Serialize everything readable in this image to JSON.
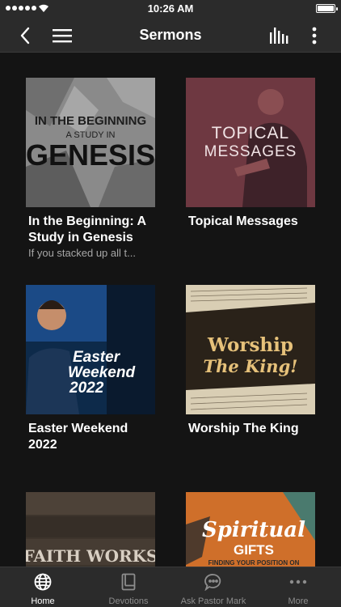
{
  "status_bar": {
    "time": "10:26 AM",
    "battery_level": 1.0
  },
  "nav": {
    "title": "Sermons"
  },
  "cards": [
    {
      "title": "In the Beginning: A Study in Genesis",
      "subtitle": "If you stacked up all t...",
      "art": {
        "line1": "IN THE BEGINNING",
        "line2": "A STUDY IN",
        "line3": "GENESIS"
      }
    },
    {
      "title": "Topical Messages",
      "subtitle": "",
      "art": {
        "line1": "TOPICAL",
        "line2": "MESSAGES"
      }
    },
    {
      "title": "Easter Weekend 2022",
      "subtitle": "",
      "art": {
        "line1": "Easter",
        "line2": "Weekend",
        "line3": "2022"
      }
    },
    {
      "title": "Worship The King",
      "subtitle": "",
      "art": {
        "line1": "Worship",
        "line2": "The King!"
      }
    },
    {
      "title": "",
      "subtitle": "",
      "art": {
        "line1": "FAITH WORKS"
      }
    },
    {
      "title": "",
      "subtitle": "",
      "art": {
        "line1": "Spiritual",
        "line2": "GIFTS",
        "line3": "FINDING YOUR POSITION ON"
      }
    }
  ],
  "tabs": [
    {
      "label": "Home",
      "icon": "globe-icon",
      "active": true
    },
    {
      "label": "Devotions",
      "icon": "book-icon",
      "active": false
    },
    {
      "label": "Ask Pastor Mark",
      "icon": "chat-bubble-icon",
      "active": false
    },
    {
      "label": "More",
      "icon": "more-dots-icon",
      "active": false
    }
  ],
  "colors": {
    "background": "#141414",
    "bar": "#2b2b2b",
    "tab_active": "#ffffff",
    "tab_inactive": "#8d8d8d"
  }
}
